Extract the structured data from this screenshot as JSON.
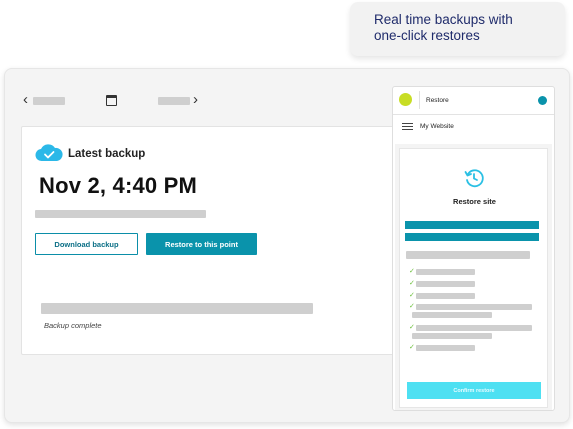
{
  "tooltip": {
    "line1": "Real time backups with",
    "line2": "one-click restores"
  },
  "backup": {
    "heading": "Latest backup",
    "date": "Nov 2, 4:40 PM",
    "download_label": "Download backup",
    "restore_label": "Restore to this point",
    "status": "Backup complete"
  },
  "phone": {
    "header_label": "Restore",
    "site_label": "My Website",
    "title": "Restore site",
    "confirm_label": "Confirm restore"
  },
  "colors": {
    "accent": "#0a93ab",
    "confirm": "#4ee0f2",
    "check": "#6bbf3a",
    "status_dot": "#c8dd25"
  },
  "icons": [
    "chevron-left-icon",
    "calendar-icon",
    "chevron-right-icon",
    "cloud-check-icon",
    "menu-icon",
    "history-icon",
    "check-icon"
  ]
}
